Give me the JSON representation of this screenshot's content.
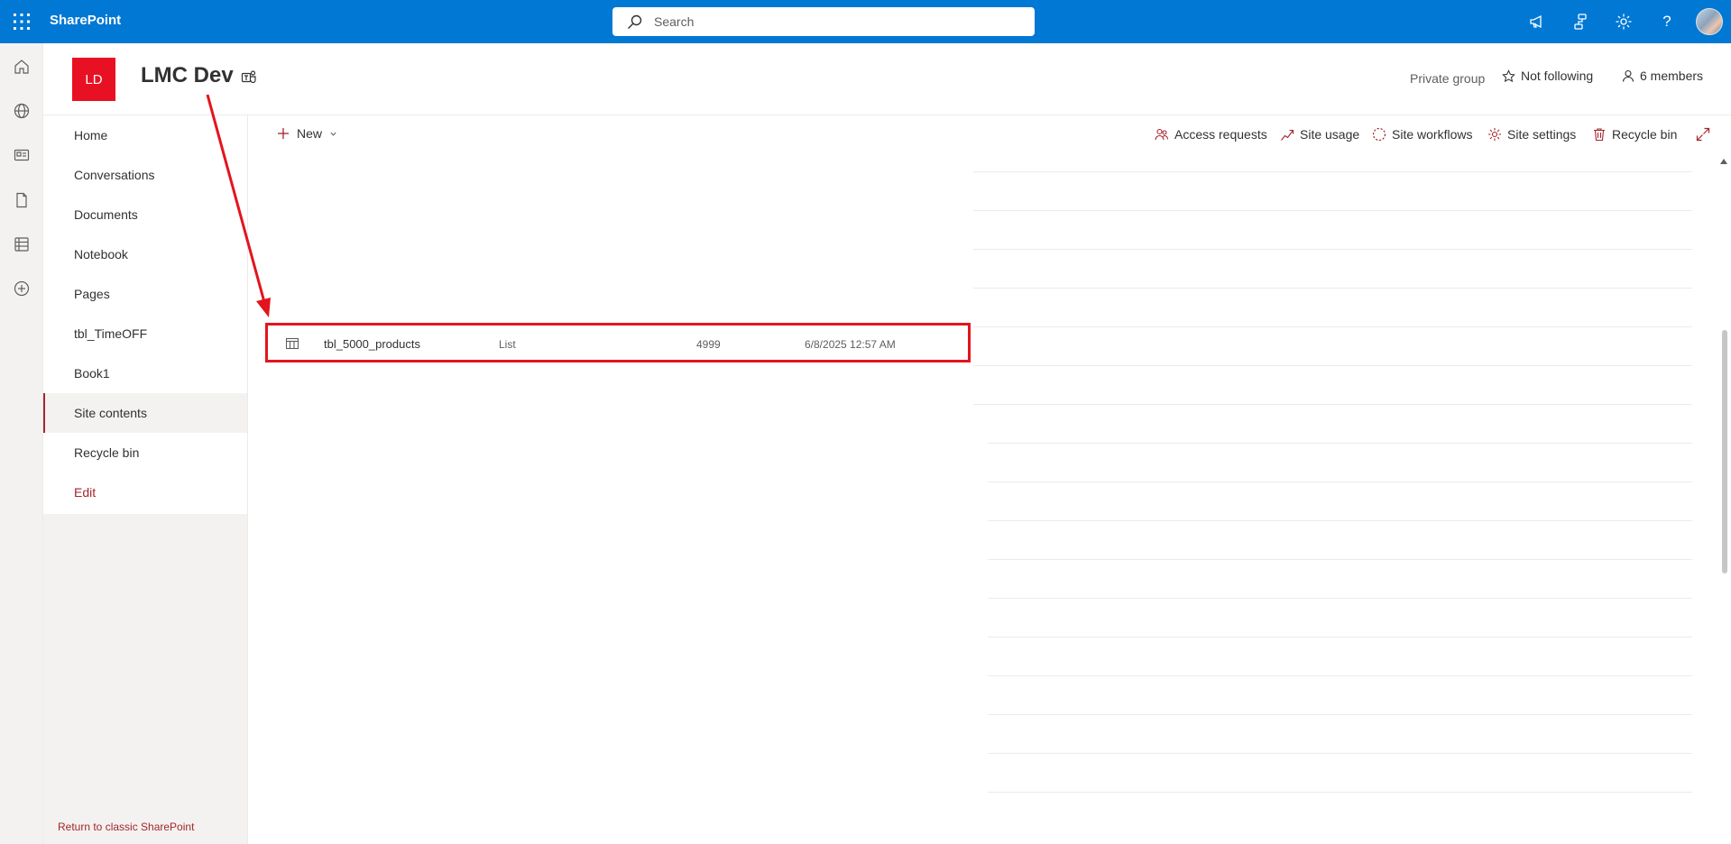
{
  "suite": {
    "brand": "SharePoint",
    "search_placeholder": "Search"
  },
  "site": {
    "logo_initials": "LD",
    "title": "LMC Dev",
    "privacy": "Private group",
    "follow_label": "Not following",
    "members_label": "6 members"
  },
  "nav": {
    "items": [
      "Home",
      "Conversations",
      "Documents",
      "Notebook",
      "Pages",
      "tbl_TimeOFF",
      "Book1",
      "Site contents",
      "Recycle bin"
    ],
    "selected": "Site contents",
    "edit_label": "Edit",
    "return_label": "Return to classic SharePoint"
  },
  "commands": {
    "new_label": "New",
    "access_requests": "Access requests",
    "site_usage": "Site usage",
    "site_workflows": "Site workflows",
    "site_settings": "Site settings",
    "recycle_bin": "Recycle bin"
  },
  "row": {
    "name": "tbl_5000_products",
    "type": "List",
    "items": "4999",
    "modified": "6/8/2025 12:57 AM"
  },
  "colors": {
    "suite_bar": "#0078d4",
    "accent": "#a4262c",
    "site_logo": "#e81123",
    "annotation": "#e3141d"
  }
}
